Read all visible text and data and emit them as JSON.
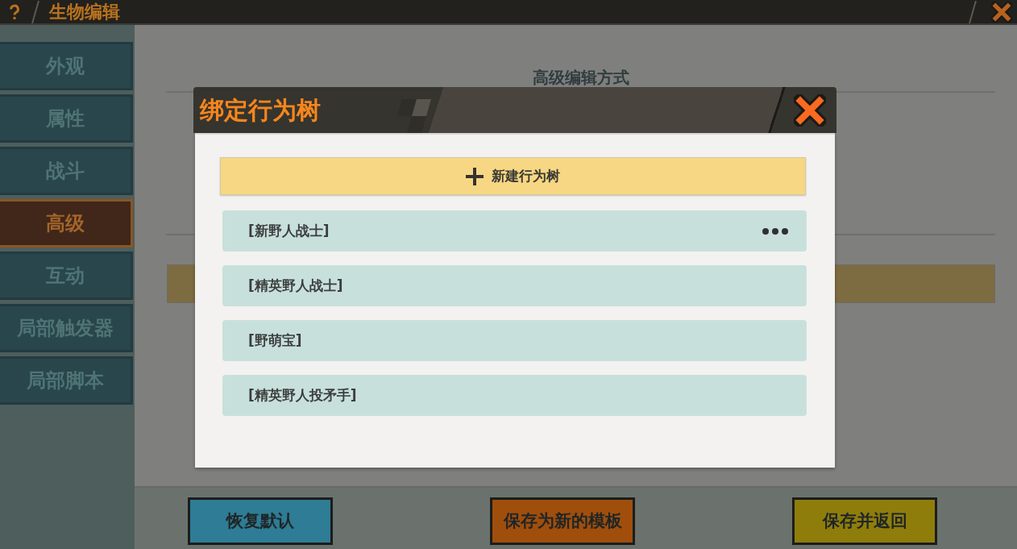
{
  "top_bar": {
    "title": "生物编辑"
  },
  "sidebar": {
    "items": [
      {
        "label": "外观",
        "selected": false
      },
      {
        "label": "属性",
        "selected": false
      },
      {
        "label": "战斗",
        "selected": false
      },
      {
        "label": "高级",
        "selected": true
      },
      {
        "label": "互动",
        "selected": false
      },
      {
        "label": "局部触发器",
        "selected": false
      },
      {
        "label": "局部脚本",
        "selected": false
      }
    ]
  },
  "main": {
    "section_title": "高级编辑方式"
  },
  "dialog": {
    "title": "绑定行为树",
    "new_button": "新建行为树",
    "items": [
      {
        "label": "[新野人战士]",
        "more_menu": true
      },
      {
        "label": "[精英野人战士]",
        "more_menu": false
      },
      {
        "label": "[野萌宝]",
        "more_menu": false
      },
      {
        "label": "[精英野人投矛手]",
        "more_menu": false
      }
    ]
  },
  "footer": {
    "buttons": [
      {
        "label": "恢复默认",
        "color": "#2e7c95"
      },
      {
        "label": "保存为新的模板",
        "color": "#a04e0c"
      },
      {
        "label": "保存并返回",
        "color": "#8f7d0b"
      }
    ]
  }
}
